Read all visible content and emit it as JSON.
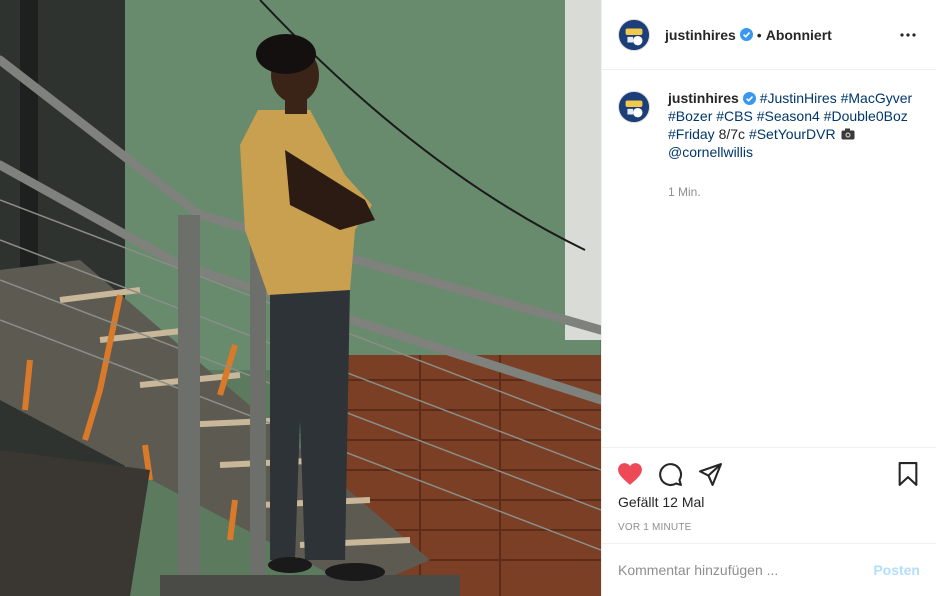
{
  "post": {
    "username": "justinhires",
    "follow_separator": "•",
    "follow_state": "Abonniert",
    "caption": {
      "username": "justinhires",
      "tags": [
        "#JustinHires",
        "#MacGyver",
        "#Bozer",
        "#CBS",
        "#Season4",
        "#Double0Boz",
        "#Friday"
      ],
      "text_after_friday": "8/7c",
      "tag_after_text": "#SetYourDVR",
      "mention": "@cornellwillis",
      "relative_time": "1 Min."
    },
    "likes_text": "Gefällt 12 Mal",
    "post_time": "VOR 1 MINUTE",
    "comment": {
      "placeholder": "Kommentar hinzufügen ...",
      "post_label": "Posten"
    }
  },
  "icons": {
    "more": "more-horizontal-icon",
    "verified": "verified-badge-icon",
    "like": "heart-filled-icon",
    "comment": "comment-bubble-icon",
    "share": "paper-plane-icon",
    "save": "bookmark-icon",
    "camera": "camera-emoji-icon"
  },
  "colors": {
    "like_active": "#ed4956",
    "link": "#00376b",
    "verified": "#3897f0",
    "post_disabled": "#b2dffc",
    "muted": "#8e8e8e"
  }
}
